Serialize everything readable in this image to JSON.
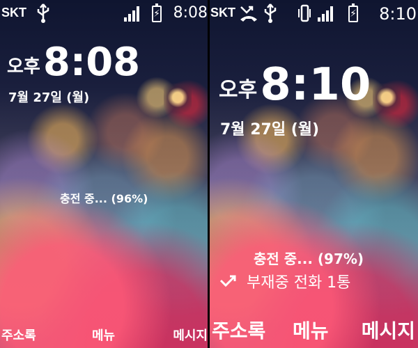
{
  "left": {
    "status": {
      "carrier": "SKT",
      "time": "8:08"
    },
    "lock": {
      "ampm": "오후",
      "time": "8:08",
      "date": "7월 27일 (월)",
      "charging": "충전 중... (96%)"
    },
    "softkeys": {
      "contacts": "주소록",
      "menu": "메뉴",
      "messages": "메시지"
    }
  },
  "right": {
    "status": {
      "carrier": "SKT",
      "time": "8:10"
    },
    "lock": {
      "ampm": "오후",
      "time": "8:10",
      "date": "7월 27일 (월)",
      "charging": "충전 중... (97%)",
      "missed_call": "부재중 전화 1통"
    },
    "softkeys": {
      "contacts": "주소록",
      "menu": "메뉴",
      "messages": "메시지"
    }
  }
}
